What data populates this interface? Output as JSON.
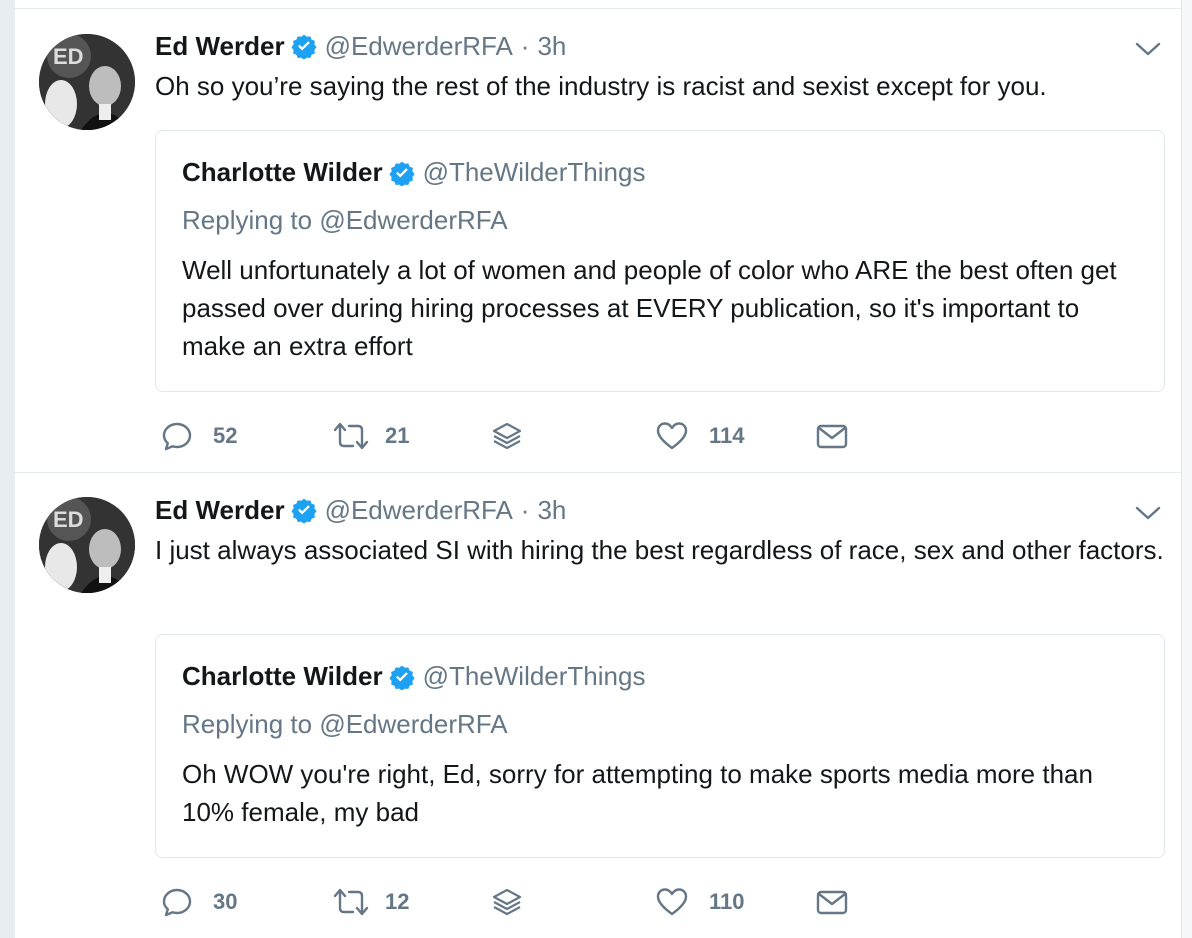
{
  "tweets": [
    {
      "author": {
        "name": "Ed Werder",
        "handle": "@EdwerderRFA"
      },
      "separator": "·",
      "time": "3h",
      "text": "Oh so you’re saying the rest of the industry is racist and sexist except for you.",
      "quote": {
        "author": {
          "name": "Charlotte Wilder",
          "handle": "@TheWilderThings"
        },
        "replying_label": "Replying to",
        "replying_to": "@EdwerderRFA",
        "text": "Well unfortunately a lot of women and people of color who ARE the best often get passed over during hiring processes at EVERY publication, so it's important to make an extra effort"
      },
      "actions": {
        "replies": "52",
        "retweets": "21",
        "likes": "114"
      }
    },
    {
      "author": {
        "name": "Ed Werder",
        "handle": "@EdwerderRFA"
      },
      "separator": "·",
      "time": "3h",
      "text": "I just always associated SI with hiring the best regardless of race, sex and other factors.",
      "quote": {
        "author": {
          "name": "Charlotte Wilder",
          "handle": "@TheWilderThings"
        },
        "replying_label": "Replying to",
        "replying_to": "@EdwerderRFA",
        "text": "Oh WOW you're right, Ed, sorry for attempting to make sports media more than 10% female, my bad"
      },
      "actions": {
        "replies": "30",
        "retweets": "12",
        "likes": "110"
      }
    }
  ],
  "colors": {
    "verified": "#1da1f2",
    "secondary_text": "#657786",
    "primary_text": "#14171a",
    "border": "#e1e8ed"
  },
  "icons": [
    "verified-badge-icon",
    "caret-down-icon",
    "reply-icon",
    "retweet-icon",
    "stack-icon",
    "heart-icon",
    "envelope-icon"
  ]
}
